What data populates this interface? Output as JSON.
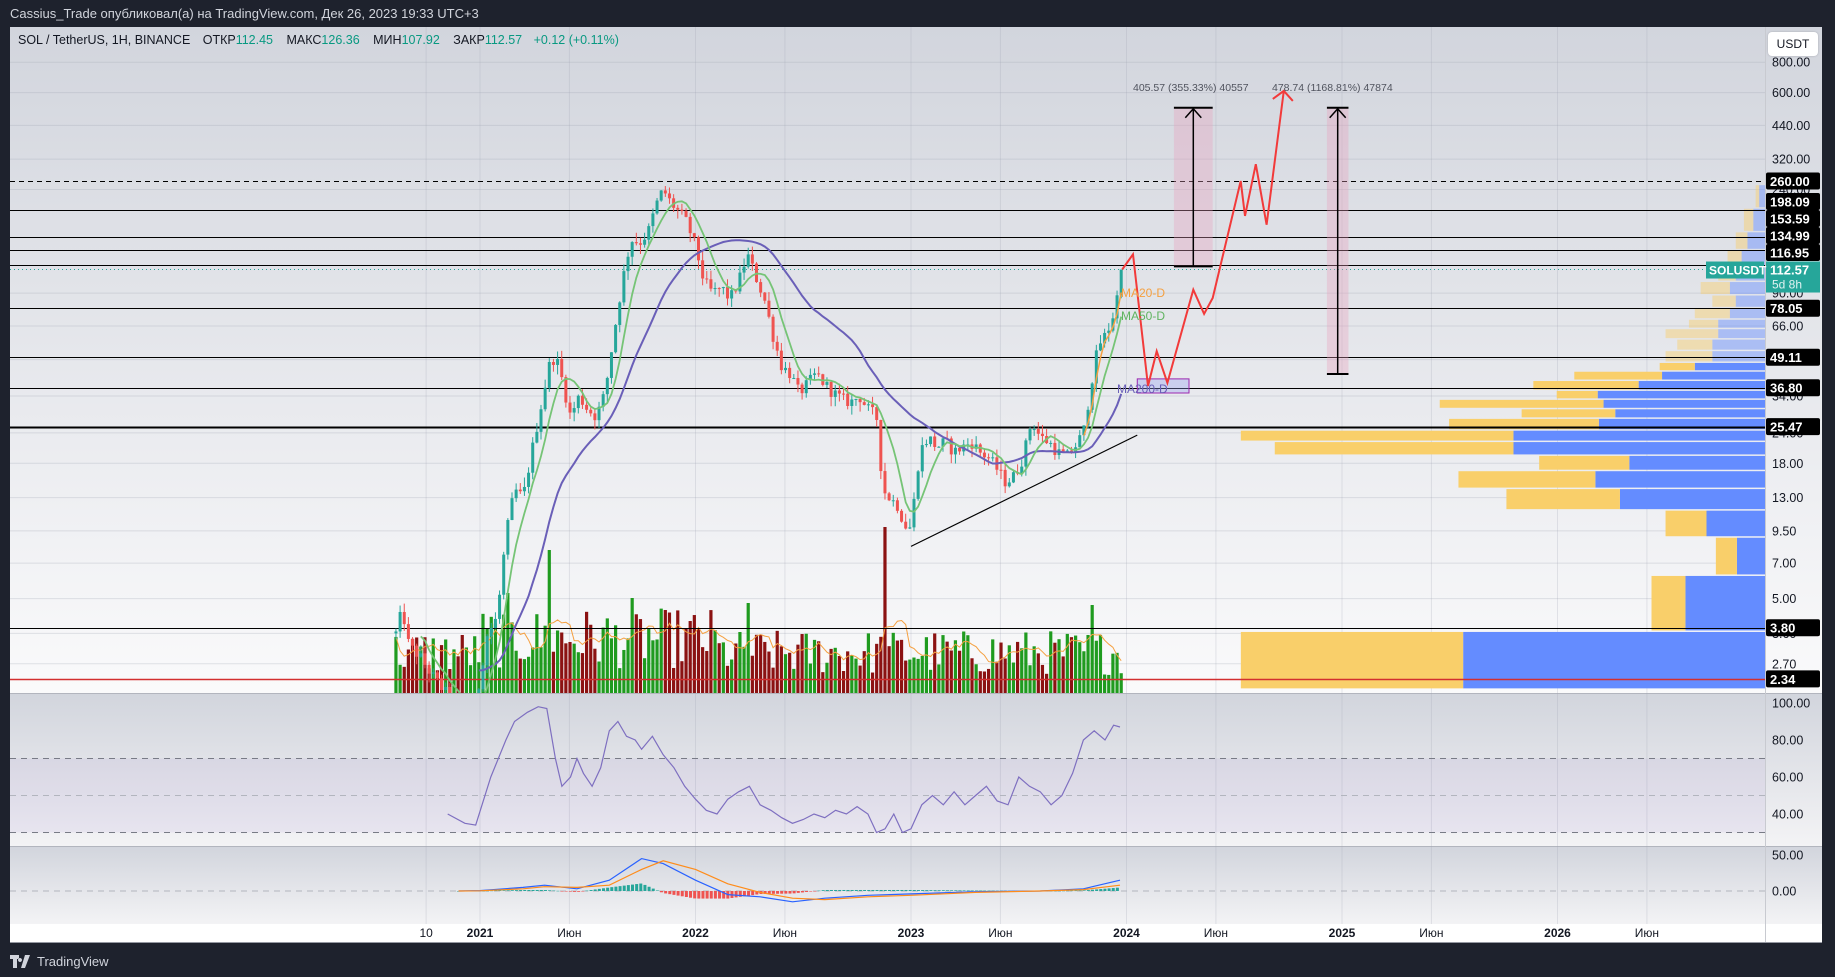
{
  "topbar": {
    "text": "Cassius_Trade опубликовал(а) на TradingView.com, Дек 26, 2023 19:33 UTC+3"
  },
  "legend": {
    "symbol": "SOL / TetherUS, 1H, BINANCE",
    "open_label": "ОТКР",
    "open": "112.45",
    "high_label": "МАКС",
    "high": "126.36",
    "low_label": "МИН",
    "low": "107.92",
    "close_label": "ЗАКР",
    "close": "112.57",
    "change": "+0.12 (+0.11%)"
  },
  "currency_button": "USDT",
  "footer": {
    "brand": "TradingView",
    "logo_icon": "tradingview-logo-icon"
  },
  "colors": {
    "up": "#26a69a",
    "down": "#ef5350",
    "vol_up": "#1f9b1f",
    "vol_down": "#8b1212",
    "ma20": "#f5a040",
    "ma50": "#76c476",
    "ma200": "#6a5fb8",
    "projection": "#f23a3a",
    "profile_up": "#f9cf6a",
    "profile_down": "#648cff",
    "rsi": "#7e6fc0",
    "macd": "#2962ff",
    "signal": "#ff8c1a",
    "accent": "#26a69a"
  },
  "chart_data": {
    "type": "candlestick",
    "title": "SOL / TetherUS, 1H, BINANCE",
    "yscale": "log",
    "ylim": [
      2.08,
      880
    ],
    "xlim": [
      2019.33,
      2027.2
    ],
    "price_ticks": [
      "800.00",
      "600.00",
      "440.00",
      "320.00",
      "240.00",
      "90.00",
      "66.00",
      "48.00",
      "34.00",
      "24.00",
      "18.00",
      "13.00",
      "9.50",
      "7.00",
      "5.00",
      "3.60",
      "2.70"
    ],
    "price_tick_values": [
      800,
      600,
      440,
      320,
      240,
      90,
      66,
      48,
      34,
      24,
      18,
      13,
      9.5,
      7,
      5,
      3.6,
      2.7
    ],
    "time_ticks": [
      {
        "label": "10",
        "date": 2020.75
      },
      {
        "label": "2021",
        "date": 2021.0
      },
      {
        "label": "Июн",
        "date": 2021.415
      },
      {
        "label": "2022",
        "date": 2022.0
      },
      {
        "label": "Июн",
        "date": 2022.415
      },
      {
        "label": "2023",
        "date": 2023.0
      },
      {
        "label": "Июн",
        "date": 2023.415
      },
      {
        "label": "2024",
        "date": 2024.0
      },
      {
        "label": "Июн",
        "date": 2024.415
      },
      {
        "label": "2025",
        "date": 2025.0
      },
      {
        "label": "Июн",
        "date": 2025.415
      },
      {
        "label": "2026",
        "date": 2026.0
      },
      {
        "label": "Июн",
        "date": 2026.415
      }
    ],
    "price_path": [
      [
        2020.61,
        3.6
      ],
      [
        2020.64,
        4.5
      ],
      [
        2020.67,
        3.2
      ],
      [
        2020.72,
        2.9
      ],
      [
        2020.78,
        2.4
      ],
      [
        2020.85,
        2.0
      ],
      [
        2020.92,
        1.6
      ],
      [
        2020.98,
        1.8
      ],
      [
        2021.03,
        3.5
      ],
      [
        2021.08,
        4.2
      ],
      [
        2021.12,
        9
      ],
      [
        2021.16,
        14
      ],
      [
        2021.2,
        13
      ],
      [
        2021.24,
        20
      ],
      [
        2021.28,
        30
      ],
      [
        2021.32,
        45
      ],
      [
        2021.35,
        50
      ],
      [
        2021.38,
        40
      ],
      [
        2021.42,
        28
      ],
      [
        2021.46,
        34
      ],
      [
        2021.5,
        30
      ],
      [
        2021.54,
        28
      ],
      [
        2021.58,
        35
      ],
      [
        2021.62,
        60
      ],
      [
        2021.66,
        100
      ],
      [
        2021.7,
        150
      ],
      [
        2021.74,
        145
      ],
      [
        2021.78,
        160
      ],
      [
        2021.82,
        210
      ],
      [
        2021.85,
        240
      ],
      [
        2021.88,
        215
      ],
      [
        2021.92,
        195
      ],
      [
        2021.96,
        175
      ],
      [
        2022.0,
        140
      ],
      [
        2022.04,
        100
      ],
      [
        2022.08,
        90
      ],
      [
        2022.12,
        95
      ],
      [
        2022.16,
        85
      ],
      [
        2022.2,
        100
      ],
      [
        2022.24,
        130
      ],
      [
        2022.28,
        105
      ],
      [
        2022.32,
        85
      ],
      [
        2022.36,
        60
      ],
      [
        2022.4,
        45
      ],
      [
        2022.44,
        42
      ],
      [
        2022.48,
        35
      ],
      [
        2022.52,
        38
      ],
      [
        2022.56,
        42
      ],
      [
        2022.6,
        38
      ],
      [
        2022.64,
        35
      ],
      [
        2022.68,
        33
      ],
      [
        2022.72,
        32
      ],
      [
        2022.76,
        34
      ],
      [
        2022.8,
        30
      ],
      [
        2022.84,
        28
      ],
      [
        2022.87,
        14
      ],
      [
        2022.9,
        13
      ],
      [
        2022.94,
        12
      ],
      [
        2022.97,
        10
      ],
      [
        2023.0,
        9.8
      ],
      [
        2023.04,
        20
      ],
      [
        2023.08,
        23
      ],
      [
        2023.12,
        21
      ],
      [
        2023.16,
        22
      ],
      [
        2023.2,
        20
      ],
      [
        2023.24,
        21
      ],
      [
        2023.28,
        22
      ],
      [
        2023.32,
        20
      ],
      [
        2023.36,
        19
      ],
      [
        2023.4,
        17
      ],
      [
        2023.44,
        15
      ],
      [
        2023.48,
        16
      ],
      [
        2023.52,
        19
      ],
      [
        2023.56,
        27
      ],
      [
        2023.6,
        23
      ],
      [
        2023.64,
        22
      ],
      [
        2023.68,
        20
      ],
      [
        2023.72,
        19
      ],
      [
        2023.76,
        21
      ],
      [
        2023.8,
        24
      ],
      [
        2023.84,
        40
      ],
      [
        2023.87,
        55
      ],
      [
        2023.9,
        60
      ],
      [
        2023.93,
        68
      ],
      [
        2023.96,
        90
      ],
      [
        2023.98,
        112.57
      ]
    ],
    "volume_spikes": [
      [
        2021.32,
        143
      ],
      [
        2022.88,
        166
      ],
      [
        2021.12,
        100
      ],
      [
        2021.7,
        95
      ],
      [
        2022.24,
        90
      ],
      [
        2023.85,
        88
      ]
    ],
    "moving_averages": [
      {
        "name": "MA20-D",
        "label": "MA20-D"
      },
      {
        "name": "MA50-D",
        "label": "MA50-D"
      },
      {
        "name": "MA200-D",
        "label": "MA200-D"
      }
    ],
    "levels": [
      {
        "price": 260.0,
        "label": "260.00",
        "style": "dashed"
      },
      {
        "price": 198.09,
        "label": "198.09",
        "style": "solid"
      },
      {
        "price": 153.59,
        "label": "153.59",
        "style": "solid"
      },
      {
        "price": 134.99,
        "label": "134.99",
        "style": "solid"
      },
      {
        "price": 116.95,
        "label": "116.95",
        "style": "solid"
      },
      {
        "price": 78.05,
        "label": "78.05",
        "style": "solid"
      },
      {
        "price": 49.11,
        "label": "49.11",
        "style": "solid"
      },
      {
        "price": 36.8,
        "label": "36.80",
        "style": "solid"
      },
      {
        "price": 25.47,
        "label": "25.47",
        "style": "thick"
      },
      {
        "price": 3.8,
        "label": "3.80",
        "style": "solid"
      },
      {
        "price": 2.34,
        "label": "2.34",
        "style": "red"
      }
    ],
    "last_price": {
      "symbol": "SOLUSDT",
      "price": 112.57,
      "label": "112.57",
      "countdown": "5d 8h"
    },
    "trendline": [
      [
        2023.0,
        8.2
      ],
      [
        2024.05,
        23.5
      ]
    ],
    "projection": [
      [
        2023.98,
        112.57
      ],
      [
        2024.03,
        130
      ],
      [
        2024.1,
        37.4
      ],
      [
        2024.14,
        52
      ],
      [
        2024.19,
        38.5
      ],
      [
        2024.31,
        93
      ],
      [
        2024.36,
        74
      ],
      [
        2024.4,
        86
      ],
      [
        2024.53,
        260
      ],
      [
        2024.55,
        187
      ],
      [
        2024.6,
        305
      ],
      [
        2024.65,
        172
      ],
      [
        2024.73,
        610
      ]
    ],
    "zone_box": {
      "from": 2024.05,
      "to": 2024.29,
      "low": 35,
      "high": 40
    },
    "measures": [
      {
        "from": 2024.22,
        "to": 2024.4,
        "low": 116,
        "high": 520,
        "label": "405.57 (355.33%) 40557"
      },
      {
        "from": 2024.93,
        "to": 2025.03,
        "low": 41.9,
        "high": 520,
        "label": "478.74 (1168.81%) 47874"
      }
    ],
    "volume_profile": [
      [
        2.11,
        3.65,
        190,
        258
      ],
      [
        3.65,
        6.2,
        29,
        68
      ],
      [
        6.2,
        8.9,
        18,
        24
      ],
      [
        8.9,
        11.5,
        35,
        50
      ],
      [
        11.5,
        14.1,
        97,
        124
      ],
      [
        14.1,
        16.7,
        117,
        145
      ],
      [
        16.7,
        19.3,
        77,
        116
      ],
      [
        19.3,
        22.0,
        204,
        215
      ],
      [
        22.0,
        24.5,
        233,
        215
      ],
      [
        24.5,
        27.4,
        128,
        142
      ],
      [
        27.4,
        30,
        80,
        128
      ],
      [
        30,
        32.8,
        140,
        138
      ],
      [
        32.8,
        35.7,
        35,
        143
      ],
      [
        35.7,
        39.2,
        90,
        108
      ],
      [
        39.2,
        42.8,
        75,
        88
      ],
      [
        42.8,
        46.5,
        30,
        60
      ],
      [
        46.5,
        52,
        40,
        45
      ],
      [
        52,
        58,
        30,
        45
      ],
      [
        58,
        64,
        45,
        40
      ],
      [
        64,
        70,
        25,
        40
      ],
      [
        70,
        78,
        30,
        30
      ],
      [
        78,
        88,
        20,
        25
      ],
      [
        88,
        100,
        25,
        30
      ],
      [
        100,
        115,
        15,
        25
      ],
      [
        115,
        135,
        12,
        20
      ],
      [
        135,
        160,
        10,
        15
      ],
      [
        160,
        200,
        8,
        10
      ],
      [
        200,
        250,
        3,
        5
      ]
    ],
    "rsi": {
      "ticks": [
        "100.00",
        "80.00",
        "60.00",
        "40.00"
      ],
      "tick_values": [
        100,
        80,
        60,
        40
      ],
      "bands": [
        70,
        50,
        30
      ],
      "values": [
        [
          2020.85,
          40
        ],
        [
          2020.93,
          35
        ],
        [
          2020.98,
          34
        ],
        [
          2021.05,
          60
        ],
        [
          2021.12,
          80
        ],
        [
          2021.16,
          90
        ],
        [
          2021.22,
          95
        ],
        [
          2021.27,
          98
        ],
        [
          2021.31,
          97
        ],
        [
          2021.35,
          70
        ],
        [
          2021.38,
          55
        ],
        [
          2021.42,
          60
        ],
        [
          2021.45,
          70
        ],
        [
          2021.48,
          62
        ],
        [
          2021.52,
          55
        ],
        [
          2021.56,
          65
        ],
        [
          2021.6,
          85
        ],
        [
          2021.64,
          90
        ],
        [
          2021.68,
          82
        ],
        [
          2021.72,
          80
        ],
        [
          2021.75,
          75
        ],
        [
          2021.8,
          82
        ],
        [
          2021.85,
          72
        ],
        [
          2021.9,
          65
        ],
        [
          2021.95,
          55
        ],
        [
          2022.0,
          48
        ],
        [
          2022.05,
          42
        ],
        [
          2022.1,
          40
        ],
        [
          2022.15,
          48
        ],
        [
          2022.2,
          52
        ],
        [
          2022.25,
          55
        ],
        [
          2022.3,
          45
        ],
        [
          2022.35,
          42
        ],
        [
          2022.4,
          38
        ],
        [
          2022.45,
          35
        ],
        [
          2022.5,
          37
        ],
        [
          2022.55,
          40
        ],
        [
          2022.6,
          38
        ],
        [
          2022.65,
          42
        ],
        [
          2022.7,
          40
        ],
        [
          2022.75,
          44
        ],
        [
          2022.8,
          40
        ],
        [
          2022.84,
          30
        ],
        [
          2022.88,
          32
        ],
        [
          2022.92,
          40
        ],
        [
          2022.96,
          30
        ],
        [
          2023.0,
          32
        ],
        [
          2023.05,
          45
        ],
        [
          2023.1,
          50
        ],
        [
          2023.15,
          45
        ],
        [
          2023.2,
          52
        ],
        [
          2023.25,
          45
        ],
        [
          2023.3,
          50
        ],
        [
          2023.35,
          55
        ],
        [
          2023.4,
          47
        ],
        [
          2023.45,
          45
        ],
        [
          2023.5,
          60
        ],
        [
          2023.55,
          55
        ],
        [
          2023.6,
          52
        ],
        [
          2023.65,
          45
        ],
        [
          2023.7,
          50
        ],
        [
          2023.75,
          62
        ],
        [
          2023.8,
          80
        ],
        [
          2023.85,
          85
        ],
        [
          2023.9,
          80
        ],
        [
          2023.94,
          88
        ],
        [
          2023.97,
          87
        ]
      ]
    },
    "macd": {
      "ticks": [
        "50.00",
        "0.00"
      ],
      "tick_values": [
        50,
        0
      ],
      "values": [
        [
          2020.9,
          0,
          0
        ],
        [
          2021.0,
          0.5,
          0.3
        ],
        [
          2021.2,
          5,
          3
        ],
        [
          2021.3,
          8,
          6
        ],
        [
          2021.45,
          3,
          5
        ],
        [
          2021.6,
          15,
          8
        ],
        [
          2021.75,
          45,
          30
        ],
        [
          2021.85,
          38,
          42
        ],
        [
          2022.0,
          15,
          30
        ],
        [
          2022.15,
          -5,
          10
        ],
        [
          2022.3,
          -8,
          -2
        ],
        [
          2022.45,
          -15,
          -10
        ],
        [
          2022.6,
          -10,
          -12
        ],
        [
          2022.8,
          -6,
          -8
        ],
        [
          2023.0,
          -4,
          -6
        ],
        [
          2023.3,
          -1,
          -2
        ],
        [
          2023.6,
          0,
          0
        ],
        [
          2023.8,
          3,
          2
        ],
        [
          2023.97,
          15,
          8
        ]
      ]
    }
  }
}
